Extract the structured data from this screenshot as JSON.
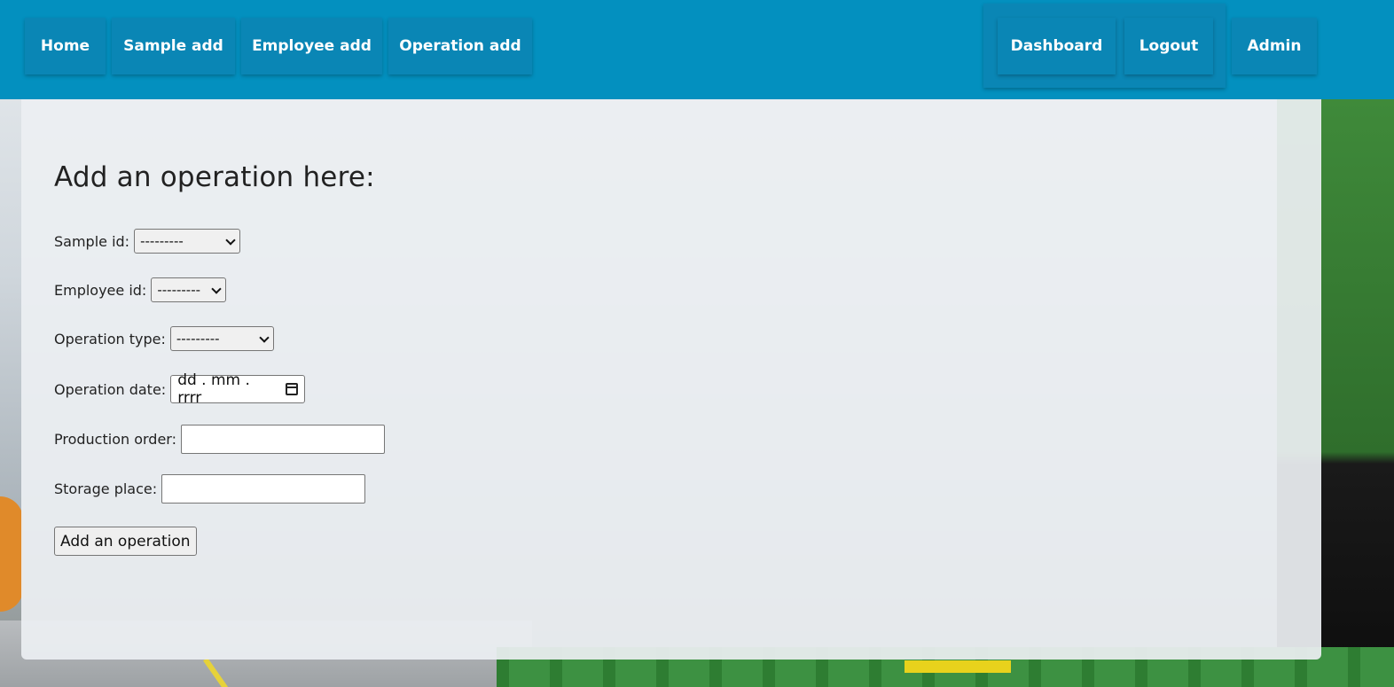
{
  "nav": {
    "home": "Home",
    "sample_add": "Sample add",
    "employee_add": "Employee add",
    "operation_add": "Operation add",
    "dashboard": "Dashboard",
    "logout": "Logout",
    "admin": "Admin"
  },
  "form": {
    "title": "Add an operation here:",
    "sample_id_label": "Sample id:",
    "sample_id_value": "---------",
    "employee_id_label": "Employee id:",
    "employee_id_value": "---------",
    "operation_type_label": "Operation type:",
    "operation_type_value": "---------",
    "operation_date_label": "Operation date:",
    "operation_date_value": "dd . mm . rrrr",
    "production_order_label": "Production order:",
    "production_order_value": "",
    "storage_place_label": "Storage place:",
    "storage_place_value": "",
    "submit_label": "Add an operation"
  },
  "colors": {
    "navbar": "#0390bf",
    "nav_button": "#0a86b5"
  }
}
